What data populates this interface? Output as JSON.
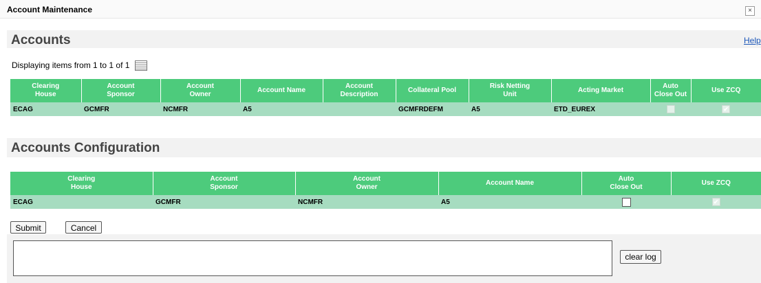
{
  "window": {
    "title": "Account Maintenance",
    "close_icon": "close-icon",
    "close_glyph": "×"
  },
  "accounts": {
    "heading": "Accounts",
    "help_label": "Help",
    "display_text": "Displaying items from 1 to 1 of 1",
    "export_icon": "grid-export-icon",
    "columns": [
      "Clearing\nHouse",
      "Account\nSponsor",
      "Account\nOwner",
      "Account Name",
      "Account\nDescription",
      "Collateral Pool",
      "Risk Netting\nUnit",
      "Acting Market",
      "Auto\nClose Out",
      "Use ZCQ"
    ],
    "row": {
      "clearing_house": "ECAG",
      "account_sponsor": "GCMFR",
      "account_owner": "NCMFR",
      "account_name": "A5",
      "account_description": "",
      "collateral_pool": "GCMFRDEFM",
      "risk_netting_unit": "A5",
      "acting_market": "ETD_EUREX",
      "auto_close_out": false,
      "use_zcq": true
    }
  },
  "configuration": {
    "heading": "Accounts Configuration",
    "columns": [
      "Clearing\nHouse",
      "Account\nSponsor",
      "Account\nOwner",
      "Account Name",
      "Auto\nClose Out",
      "Use ZCQ"
    ],
    "row": {
      "clearing_house": "ECAG",
      "account_sponsor": "GCMFR",
      "account_owner": "NCMFR",
      "account_name": "A5",
      "auto_close_out": false,
      "use_zcq": true
    }
  },
  "actions": {
    "submit_label": "Submit",
    "cancel_label": "Cancel",
    "clear_log_label": "clear log"
  },
  "log": {
    "text": ""
  },
  "colors": {
    "header_green": "#4dcb7c",
    "row_green": "#a6dcc0",
    "link_blue": "#1a55b8",
    "panel_gray": "#f2f2f2"
  }
}
